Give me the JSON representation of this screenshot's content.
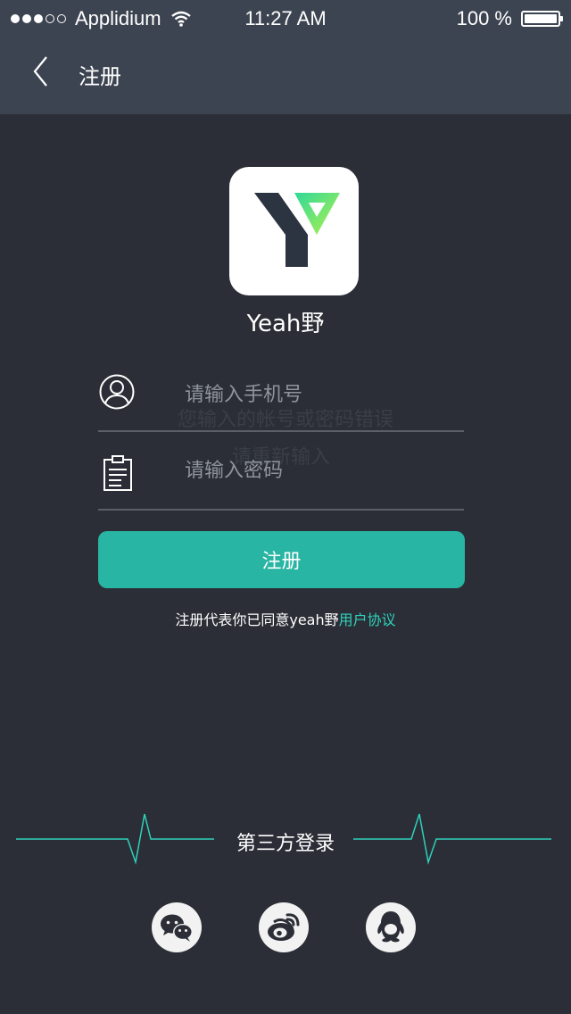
{
  "status_bar": {
    "carrier": "Applidium",
    "time": "11:27 AM",
    "battery": "100 %"
  },
  "nav": {
    "title": "注册"
  },
  "app": {
    "name": "Yeah野"
  },
  "form": {
    "phone_placeholder": "请输入手机号",
    "password_placeholder": "请输入密码",
    "error_line1": "您输入的帐号或密码错误",
    "error_line2": "请重新输入",
    "submit_label": "注册"
  },
  "agreement": {
    "prefix": "注册代表你已同意yeah野",
    "link": "用户协议"
  },
  "third_party": {
    "label": "第三方登录",
    "providers": [
      "wechat",
      "weibo",
      "qq"
    ]
  },
  "colors": {
    "background": "#2b2e36",
    "header": "#3d4451",
    "accent": "#28b5a3",
    "link": "#2fd1bb",
    "pulse": "#2fd1bb"
  },
  "icons": [
    "back-arrow-icon",
    "wifi-icon",
    "user-icon",
    "clipboard-icon",
    "wechat-icon",
    "weibo-icon",
    "qq-icon"
  ]
}
